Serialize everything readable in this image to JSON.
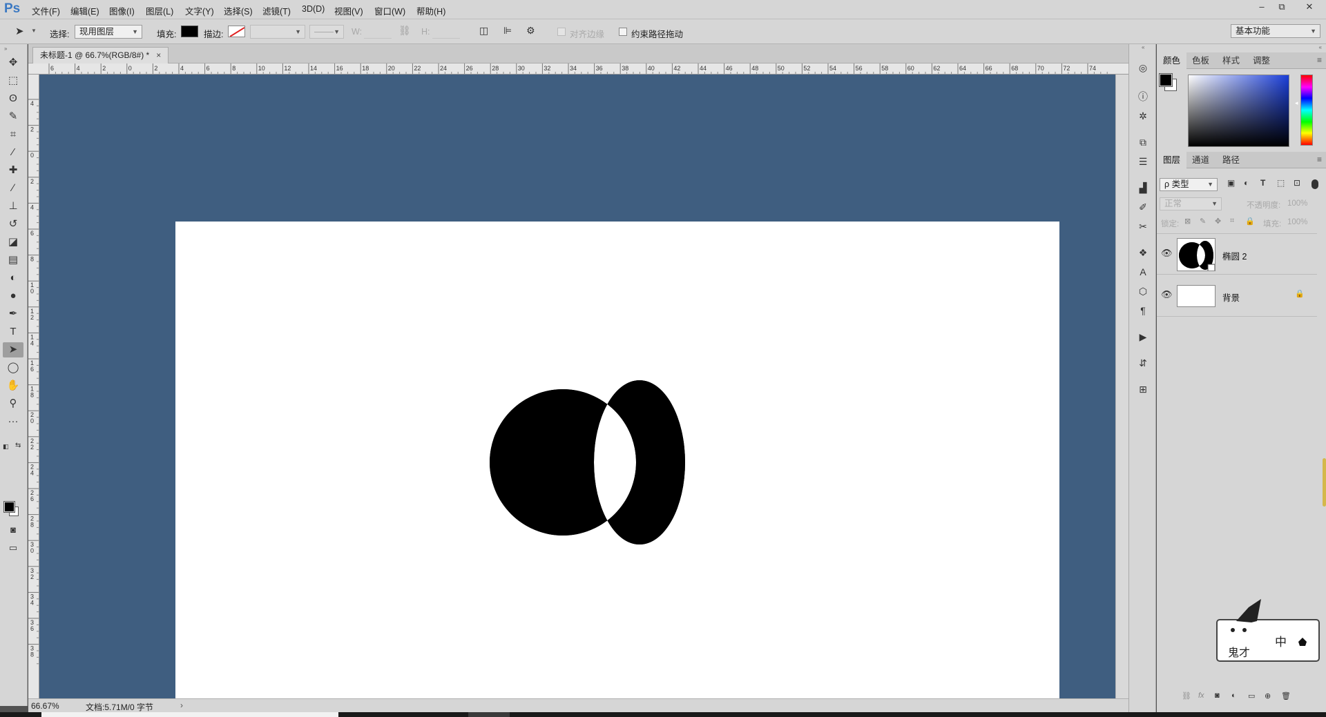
{
  "app": {
    "logo": "Ps"
  },
  "menu": [
    "文件(F)",
    "编辑(E)",
    "图像(I)",
    "图层(L)",
    "文字(Y)",
    "选择(S)",
    "滤镜(T)",
    "3D(D)",
    "视图(V)",
    "窗口(W)",
    "帮助(H)"
  ],
  "window_controls": {
    "minimize": "–",
    "restore": "⧉",
    "close": "✕"
  },
  "options": {
    "select_label": "选择:",
    "select_value": "现用图层",
    "fill_label": "填充:",
    "fill_color": "#000000",
    "stroke_label": "描边:",
    "w_label": "W:",
    "h_label": "H:",
    "align_edges_label": "对齐边缘",
    "constrain_path_label": "约束路径拖动",
    "workspace": "基本功能"
  },
  "document": {
    "tab_title": "未标题-1 @ 66.7%(RGB/8#) *",
    "tab_close": "×",
    "canvas_color": "#ffffff",
    "pasteboard_color": "#3f5e80",
    "shape_color": "#000000"
  },
  "rulers": {
    "top_labels": [
      "6",
      "4",
      "2",
      "0",
      "2",
      "4",
      "6",
      "8",
      "10",
      "12",
      "14",
      "16",
      "18",
      "20",
      "22",
      "24",
      "26",
      "28",
      "30",
      "32",
      "34",
      "36",
      "38",
      "40",
      "42",
      "44",
      "46",
      "48",
      "50",
      "52",
      "54",
      "56",
      "58",
      "60",
      "62",
      "64",
      "66",
      "68",
      "70",
      "72",
      "74"
    ],
    "left_labels": [
      "4",
      "2",
      "0",
      "2",
      "4",
      "6",
      "8",
      "10",
      "12",
      "14",
      "16",
      "18",
      "20",
      "22",
      "24",
      "26",
      "28",
      "30",
      "32",
      "34",
      "36",
      "38"
    ]
  },
  "status": {
    "zoom": "66.67%",
    "doc_info": "文档:5.71M/0 字节",
    "arrow": "›"
  },
  "tools": [
    {
      "name": "move-tool",
      "glyph": "✥"
    },
    {
      "name": "marquee-tool",
      "glyph": "⬚"
    },
    {
      "name": "lasso-tool",
      "glyph": "ʘ"
    },
    {
      "name": "quick-select-tool",
      "glyph": "✎"
    },
    {
      "name": "crop-tool",
      "glyph": "⌗"
    },
    {
      "name": "eyedropper-tool",
      "glyph": "⁄"
    },
    {
      "name": "healing-brush-tool",
      "glyph": "✚"
    },
    {
      "name": "brush-tool",
      "glyph": "∕"
    },
    {
      "name": "clone-stamp-tool",
      "glyph": "⊥"
    },
    {
      "name": "history-brush-tool",
      "glyph": "↺"
    },
    {
      "name": "eraser-tool",
      "glyph": "◪"
    },
    {
      "name": "gradient-tool",
      "glyph": "▤"
    },
    {
      "name": "blur-tool",
      "glyph": "◐"
    },
    {
      "name": "dodge-tool",
      "glyph": "●"
    },
    {
      "name": "pen-tool",
      "glyph": "✒"
    },
    {
      "name": "type-tool",
      "glyph": "T"
    },
    {
      "name": "path-select-tool",
      "glyph": "➤"
    },
    {
      "name": "ellipse-tool",
      "glyph": "◯"
    },
    {
      "name": "hand-tool",
      "glyph": "✋"
    },
    {
      "name": "zoom-tool",
      "glyph": "⚲"
    },
    {
      "name": "more-tools",
      "glyph": "···"
    }
  ],
  "active_tool": "path-select-tool",
  "colors": {
    "foreground": "#000000",
    "background": "#ffffff"
  },
  "panels": {
    "color_tabs": [
      "颜色",
      "色板",
      "样式",
      "调整"
    ],
    "layers_tabs": [
      "图层",
      "通道",
      "路径"
    ],
    "filter_kind": "ρ 类型",
    "blend_mode": "正常",
    "opacity_label": "不透明度:",
    "opacity_value": "100%",
    "lock_label": "锁定:",
    "fill_label": "填充:",
    "fill_value": "100%",
    "menu_glyph": "≡"
  },
  "layers": [
    {
      "name": "椭圆 2",
      "visible": true,
      "locked": false
    },
    {
      "name": "背景",
      "visible": true,
      "locked": true
    }
  ],
  "dock_icons": [
    "history-icon",
    "info-icon",
    "navigator-icon",
    "clone-source-icon",
    "properties-icon",
    "histogram-icon",
    "brush-presets-icon",
    "tool-presets-icon",
    "3d-icon",
    "character-icon",
    "cube-icon",
    "paragraph-icon",
    "actions-icon",
    "layer-comps-icon",
    "measurement-icon"
  ],
  "mascot": {
    "text1": "中",
    "text2": "鬼才"
  }
}
